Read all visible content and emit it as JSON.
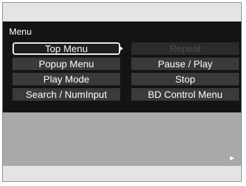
{
  "menu": {
    "title": "Menu",
    "items": [
      {
        "label": "Top Menu",
        "state": "selected"
      },
      {
        "label": "Repeat",
        "state": "disabled"
      },
      {
        "label": "Popup Menu",
        "state": "normal"
      },
      {
        "label": "Pause / Play",
        "state": "normal"
      },
      {
        "label": "Play Mode",
        "state": "normal"
      },
      {
        "label": "Stop",
        "state": "normal"
      },
      {
        "label": "Search / NumInput",
        "state": "normal"
      },
      {
        "label": "BD Control Menu",
        "state": "normal"
      }
    ]
  },
  "icons": {
    "play_indicator": "play-triangle-icon"
  },
  "colors": {
    "panel_background": "#141414",
    "button_background": "#3a3a3a",
    "disabled_text": "#4c4c4c",
    "lower_area": "#a9a9a9"
  }
}
